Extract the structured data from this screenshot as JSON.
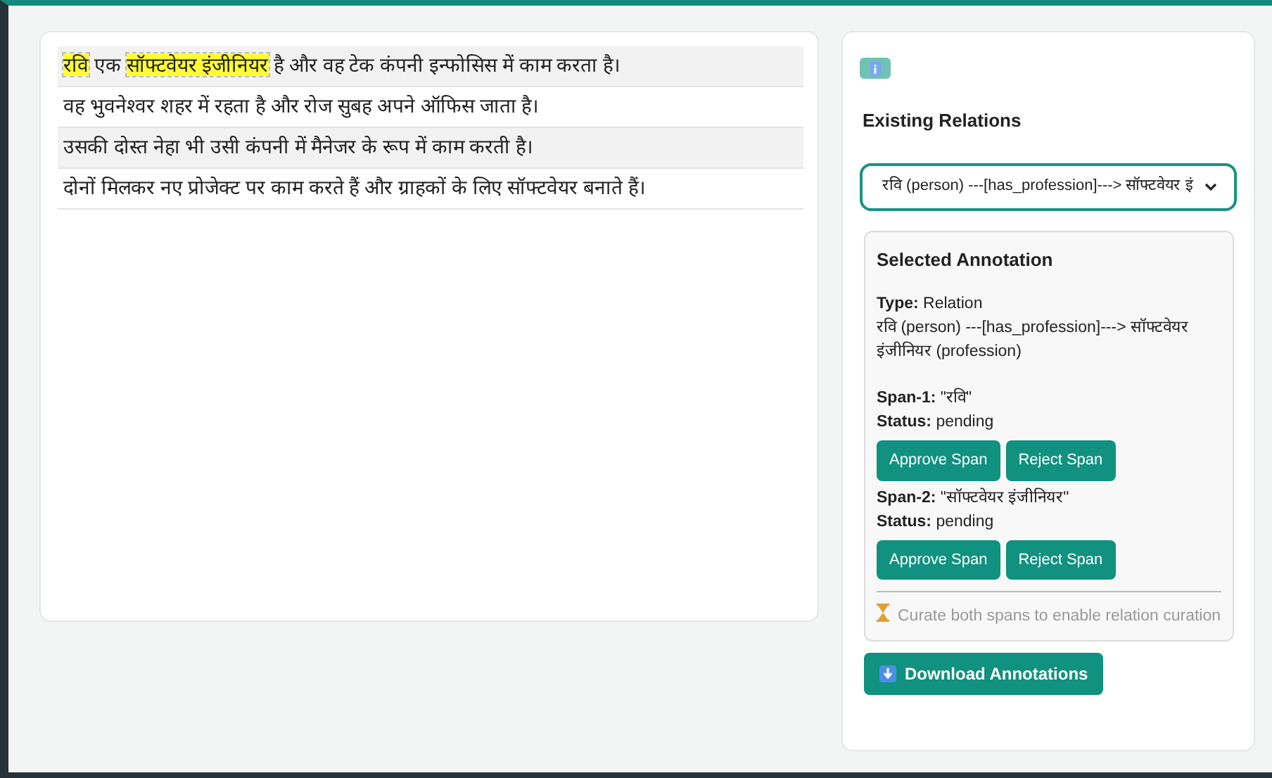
{
  "sentences": [
    {
      "segments": [
        {
          "text": "रवि",
          "highlighted": true
        },
        {
          "text": " एक ",
          "highlighted": false
        },
        {
          "text": "सॉफ्टवेयर इंजीनियर",
          "highlighted": true
        },
        {
          "text": " है और वह टेक कंपनी इन्फोसिस में काम करता है।",
          "highlighted": false
        }
      ]
    },
    {
      "segments": [
        {
          "text": "वह भुवनेश्वर शहर में रहता है और रोज सुबह अपने ऑफिस जाता है।",
          "highlighted": false
        }
      ]
    },
    {
      "segments": [
        {
          "text": "उसकी दोस्त नेहा भी उसी कंपनी में मैनेजर के रूप में काम करती है।",
          "highlighted": false
        }
      ]
    },
    {
      "segments": [
        {
          "text": "दोनों मिलकर नए प्रोजेक्ट पर काम करते हैं और ग्राहकों के लिए सॉफ्टवेयर बनाते हैं।",
          "highlighted": false
        }
      ]
    }
  ],
  "sidebar": {
    "heading": "Existing Relations",
    "relation_select": {
      "value": "रवि (person) ---[has_profession]---> सॉफ्टवेयर इं"
    },
    "annotation": {
      "title": "Selected Annotation",
      "type_label": "Type:",
      "type": "Relation",
      "relation": "रवि (person) ---[has_profession]---> सॉफ्टवेयर इंजीनियर (profession)",
      "spans": [
        {
          "label": "Span-1:",
          "text": "\"रवि\"",
          "status_label": "Status:",
          "status": "pending",
          "buttons": [
            "Approve Span",
            "Reject Span"
          ]
        },
        {
          "label": "Span-2:",
          "text": "\"सॉफ्टवेयर इंजीनियर\"",
          "status_label": "Status:",
          "status": "pending",
          "buttons": [
            "Approve Span",
            "Reject Span"
          ]
        }
      ],
      "note": "Curate both spans to enable relation curation"
    },
    "download_button": "Download Annotations"
  }
}
